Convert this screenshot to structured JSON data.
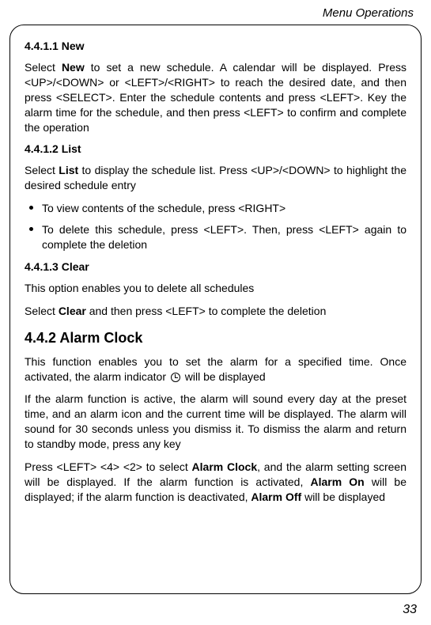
{
  "header": {
    "title": "Menu Operations"
  },
  "sections": {
    "new": {
      "heading": "4.4.1.1 New",
      "para_parts": {
        "p1": "Select ",
        "bold1": "New",
        "p2": " to set a new schedule. A calendar will be displayed. Press <UP>/<DOWN> or <LEFT>/<RIGHT> to reach the desired date, and then press <SELECT>. Enter the schedule contents and press <LEFT>. Key the alarm time for the schedule, and then press <LEFT> to confirm and complete the operation"
      }
    },
    "list": {
      "heading": "4.4.1.2 List",
      "para_parts": {
        "p1": "Select ",
        "bold1": "List",
        "p2": " to display the schedule list. Press <UP>/<DOWN> to highlight the desired schedule entry"
      },
      "bullets": [
        "To view contents of the schedule, press <RIGHT>",
        "To delete this schedule, press <LEFT>. Then, press <LEFT> again to complete the deletion"
      ]
    },
    "clear": {
      "heading": "4.4.1.3 Clear",
      "para1": "This option enables you to delete all schedules",
      "para2_parts": {
        "p1": "Select ",
        "bold1": "Clear",
        "p2": " and then press <LEFT> to complete the deletion"
      }
    },
    "alarm": {
      "heading": "4.4.2 Alarm Clock",
      "para1_parts": {
        "p1": "This function enables you to set the alarm for a specified time. Once activated, the alarm indicator ",
        "p2": " will be displayed"
      },
      "para2": "If the alarm function is active, the alarm will sound every day at the preset time, and an alarm icon and the current time will be displayed. The alarm will sound for 30 seconds unless you dismiss it. To dismiss the alarm and return to standby mode, press any key",
      "para3_parts": {
        "p1": "Press <LEFT> <4> <2> to select ",
        "bold1": "Alarm Clock",
        "p2": ", and the alarm setting screen will be displayed. If the alarm function is activated, ",
        "bold2": "Alarm On",
        "p3": " will be displayed; if the alarm function is deactivated, ",
        "bold3": "Alarm Off",
        "p4": " will be displayed"
      }
    }
  },
  "page_number": "33"
}
